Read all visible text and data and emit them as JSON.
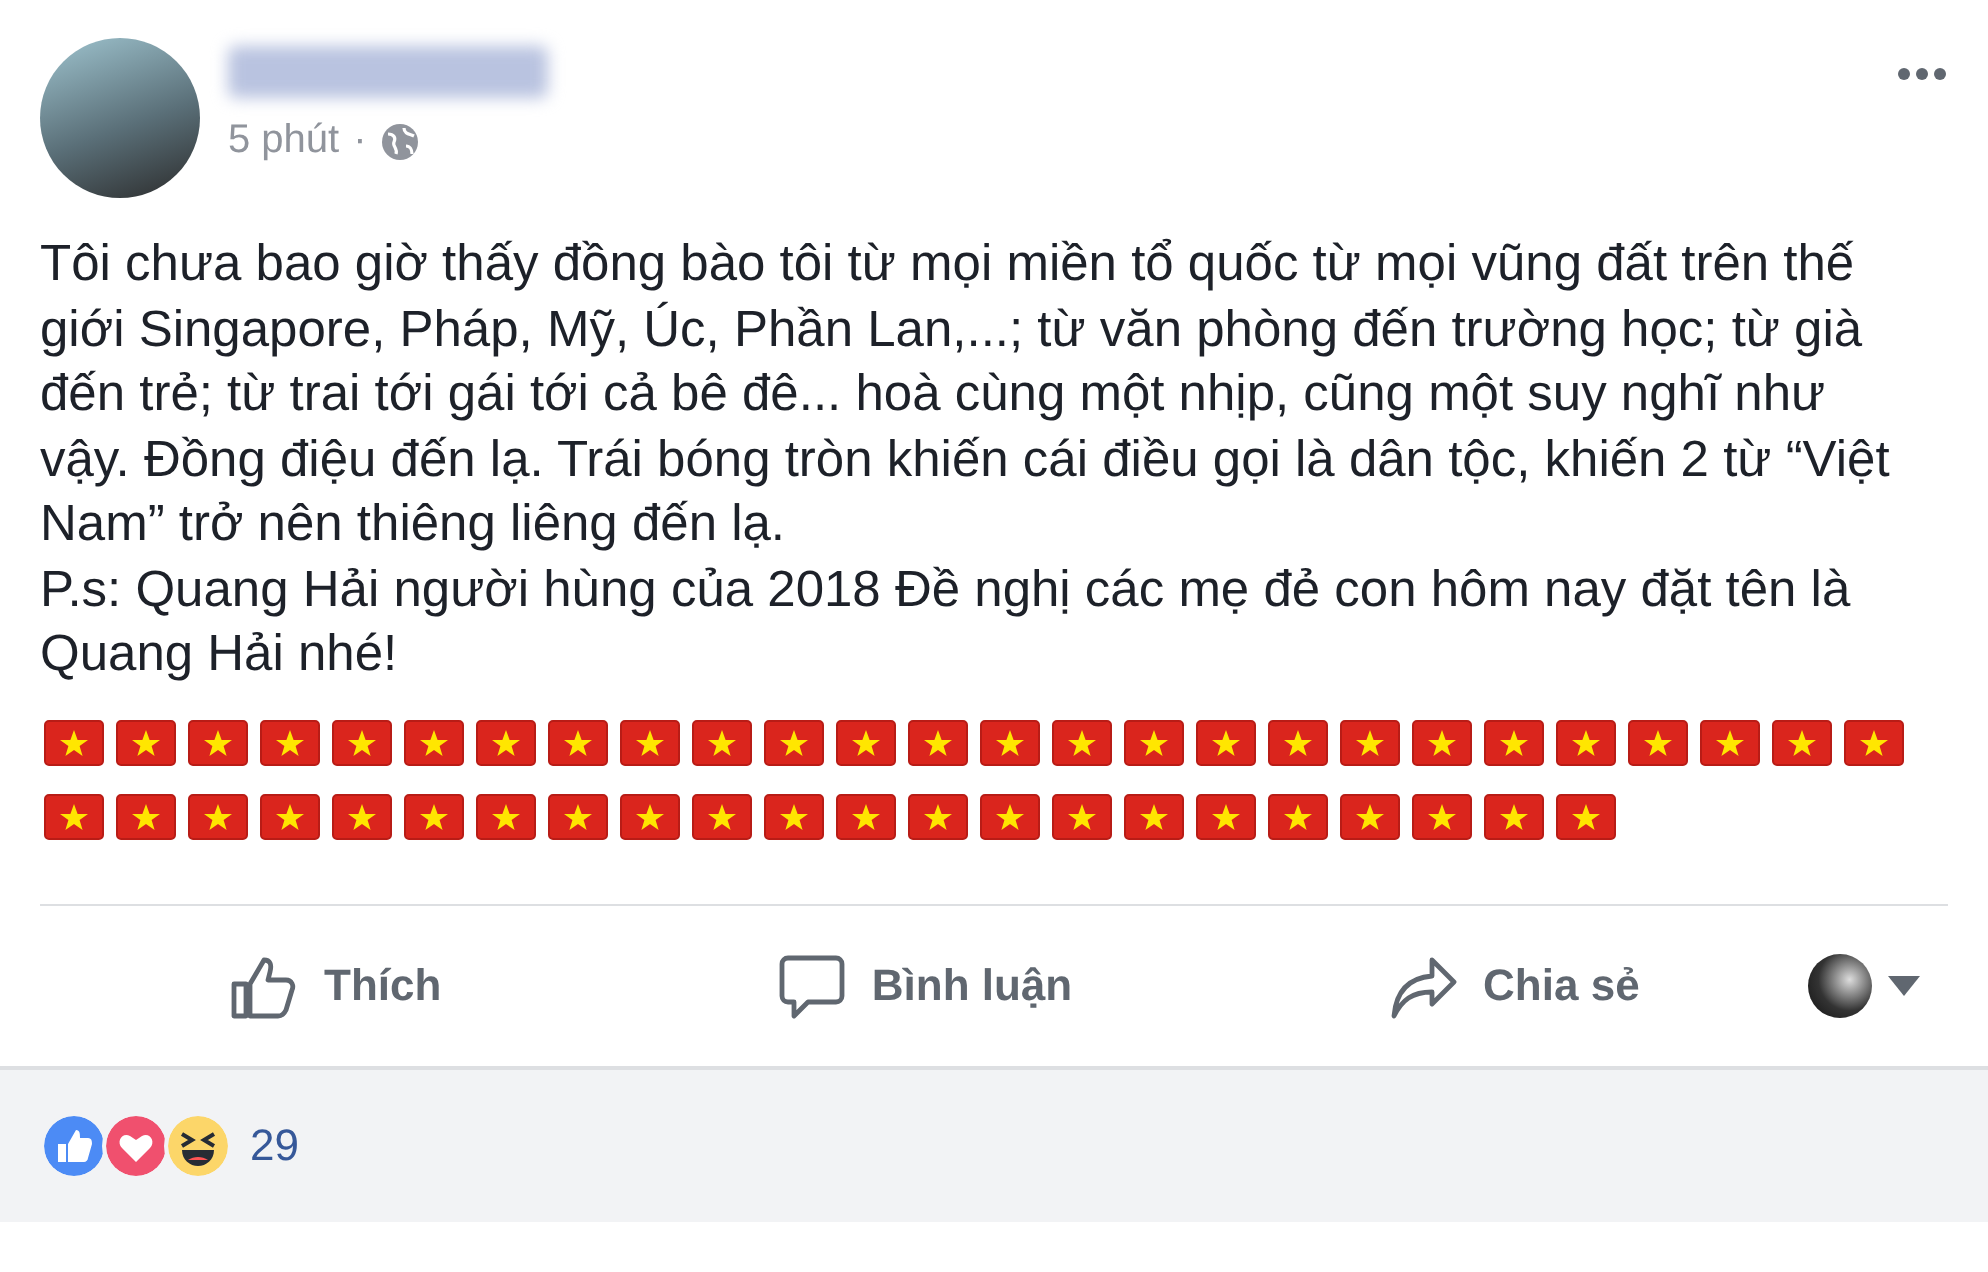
{
  "post": {
    "time": "5 phút",
    "separator": "·",
    "text": "Tôi chưa bao giờ thấy đồng bào tôi từ mọi miền tổ quốc từ mọi vũng đất trên thế giới Singapore, Pháp, Mỹ, Úc, Phần Lan,...; từ văn phòng đến trường học; từ già đến trẻ; từ trai tới gái tới cả bê đê... hoà cùng một nhịp, cũng một suy nghĩ như vậy. Đồng điệu đến lạ. Trái bóng tròn khiến cái điều gọi là dân tộc, khiến 2 từ “Việt Nam” trở nên thiêng liêng đến lạ.\nP.s: Quang Hải người hùng của 2018 Đề nghị các mẹ đẻ con hôm nay đặt tên là Quang Hải nhé!",
    "flag_rows": [
      {
        "flags": [
          {
            "kind": "vn"
          },
          {
            "kind": "vn"
          },
          {
            "kind": "vn"
          },
          {
            "kind": "vn"
          },
          {
            "kind": "vn"
          },
          {
            "kind": "vn"
          },
          {
            "kind": "vn"
          },
          {
            "kind": "vn"
          },
          {
            "kind": "vn"
          },
          {
            "kind": "vn"
          },
          {
            "kind": "vn"
          },
          {
            "kind": "vn"
          },
          {
            "kind": "vn"
          },
          {
            "kind": "vn"
          },
          {
            "kind": "vn"
          },
          {
            "kind": "vn"
          },
          {
            "kind": "vn"
          },
          {
            "kind": "vn"
          },
          {
            "kind": "vn"
          },
          {
            "kind": "vn"
          },
          {
            "kind": "vn"
          },
          {
            "kind": "vn"
          },
          {
            "kind": "vn"
          },
          {
            "kind": "vn"
          },
          {
            "kind": "vn"
          },
          {
            "kind": "vn"
          }
        ]
      },
      {
        "flags": [
          {
            "kind": "vn"
          },
          {
            "kind": "vn"
          },
          {
            "kind": "vn"
          },
          {
            "kind": "vn"
          },
          {
            "kind": "vn"
          },
          {
            "kind": "vn"
          },
          {
            "kind": "vn"
          },
          {
            "kind": "vn"
          },
          {
            "kind": "vn"
          },
          {
            "kind": "vn"
          },
          {
            "kind": "vn"
          },
          {
            "kind": "vn"
          },
          {
            "kind": "vn"
          },
          {
            "kind": "vn"
          },
          {
            "kind": "vn"
          },
          {
            "kind": "vn"
          },
          {
            "kind": "vn"
          },
          {
            "kind": "vn"
          },
          {
            "kind": "vn"
          },
          {
            "kind": "vn"
          },
          {
            "kind": "vn"
          },
          {
            "kind": "vn"
          }
        ]
      }
    ]
  },
  "actions": [
    {
      "kind": "like",
      "label": "Thích"
    },
    {
      "kind": "comment",
      "label": "Bình luận"
    },
    {
      "kind": "share",
      "label": "Chia sẻ"
    }
  ],
  "reactions": {
    "types": [
      {
        "kind": "like"
      },
      {
        "kind": "love"
      },
      {
        "kind": "haha"
      }
    ],
    "count": "29"
  }
}
